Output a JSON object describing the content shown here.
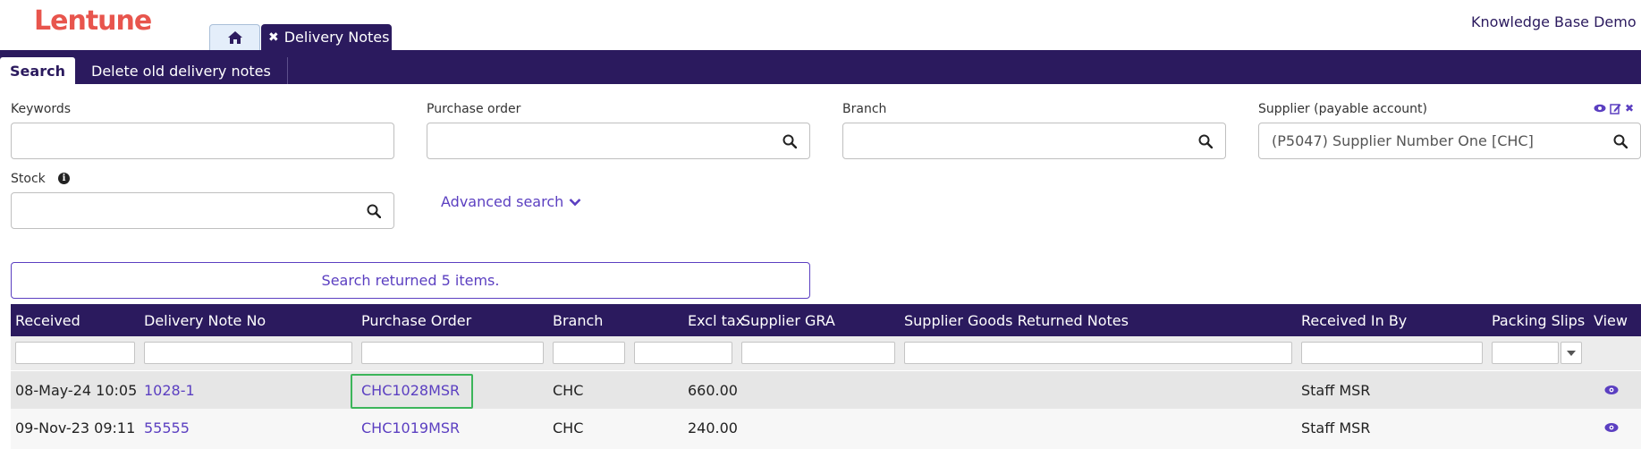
{
  "app": {
    "logo": "Lentune",
    "active_tab": "Delivery Notes",
    "tenant": "Knowledge Base Demo"
  },
  "nav": {
    "search": "Search",
    "delete_old": "Delete old delivery notes"
  },
  "form": {
    "keywords_label": "Keywords",
    "keywords_value": "",
    "po_label": "Purchase order",
    "po_value": "",
    "branch_label": "Branch",
    "branch_value": "",
    "supplier_label": "Supplier (payable account)",
    "supplier_value": "(P5047) Supplier Number One [CHC]",
    "stock_label": "Stock",
    "stock_value": "",
    "advanced": "Advanced search"
  },
  "result_text": "Search returned 5 items.",
  "table": {
    "columns": [
      "Received",
      "Delivery Note No",
      "Purchase Order",
      "Branch",
      "Excl tax",
      "Supplier GRA",
      "Supplier Goods Returned Notes",
      "Received In By",
      "Packing Slips",
      "View"
    ],
    "rows": [
      {
        "received": "08-May-24 10:05",
        "dn": "1028-1",
        "po": "CHC1028MSR",
        "branch": "CHC",
        "excl": "660.00",
        "gra": "",
        "sgrn": "",
        "by": "Staff MSR",
        "slips": ""
      },
      {
        "received": "09-Nov-23 09:11",
        "dn": "55555",
        "po": "CHC1019MSR",
        "branch": "CHC",
        "excl": "240.00",
        "gra": "",
        "sgrn": "",
        "by": "Staff MSR",
        "slips": ""
      }
    ]
  },
  "colors": {
    "brand": "#2b1a5e",
    "logo": "#e8554d",
    "link": "#5b3fc1",
    "highlight": "#3cb55a"
  }
}
